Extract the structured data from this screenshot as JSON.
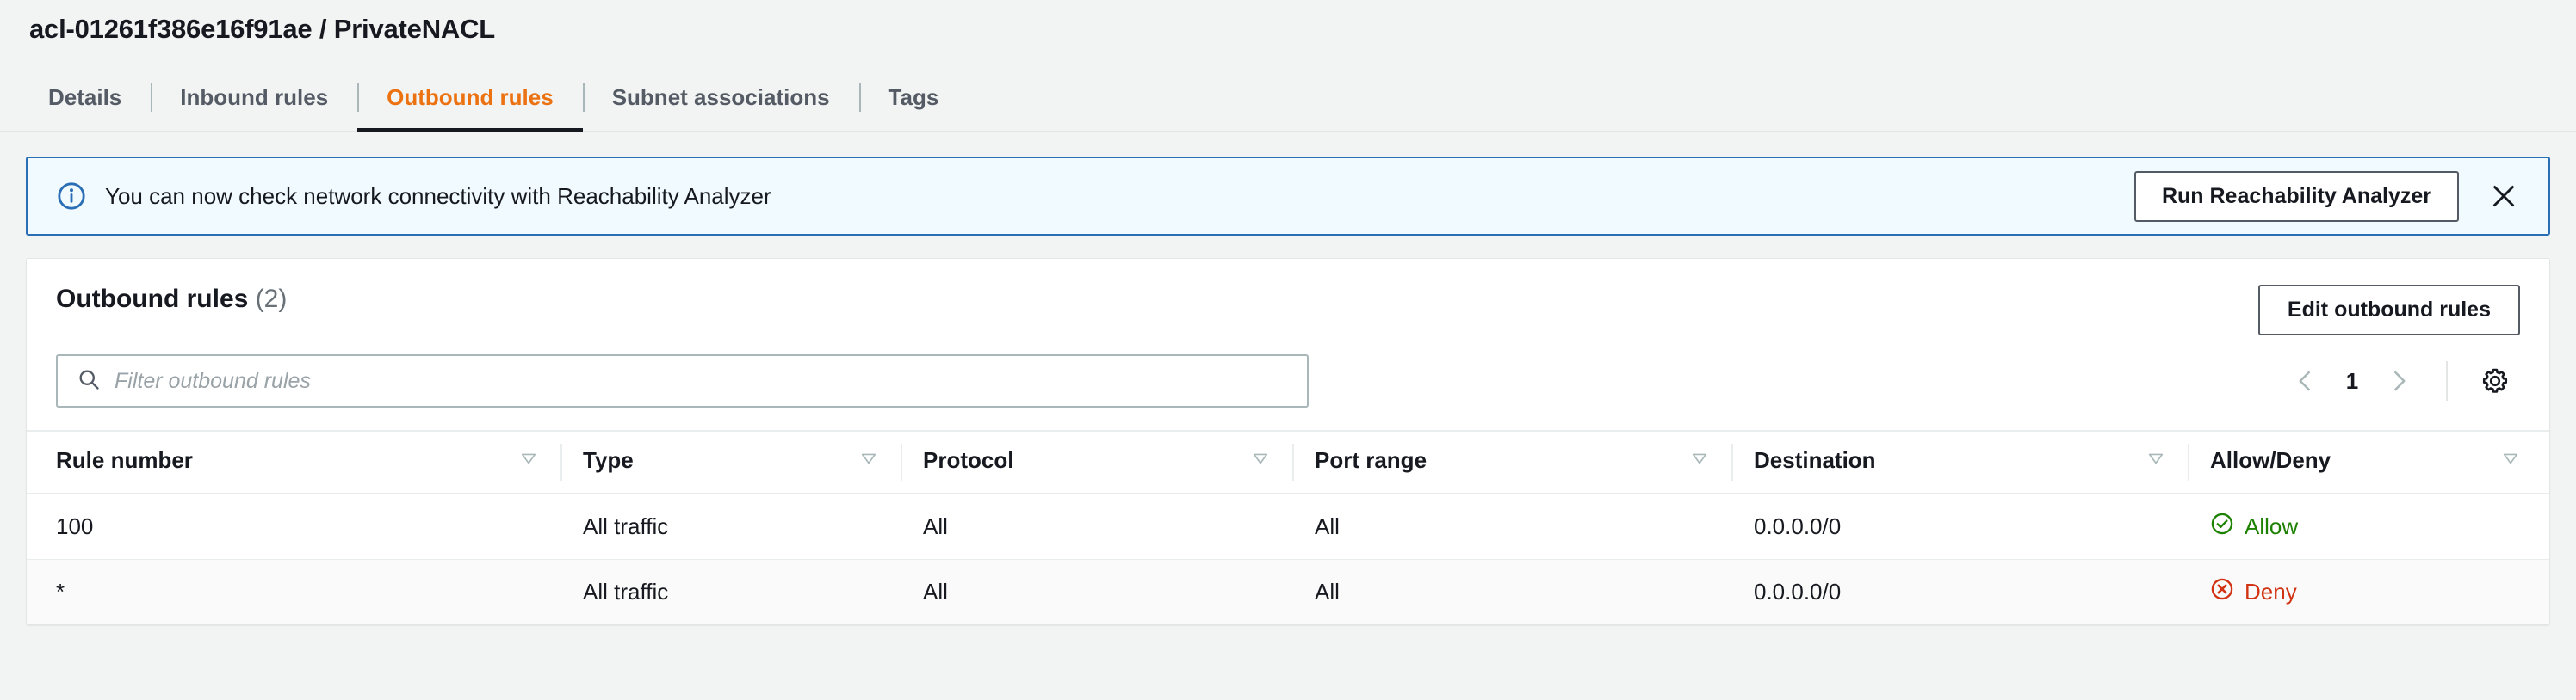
{
  "header": {
    "title": "acl-01261f386e16f91ae / PrivateNACL"
  },
  "tabs": [
    {
      "label": "Details",
      "active": false
    },
    {
      "label": "Inbound rules",
      "active": false
    },
    {
      "label": "Outbound rules",
      "active": true
    },
    {
      "label": "Subnet associations",
      "active": false
    },
    {
      "label": "Tags",
      "active": false
    }
  ],
  "banner": {
    "icon": "info-circle-icon",
    "message": "You can now check network connectivity with Reachability Analyzer",
    "action_label": "Run Reachability Analyzer",
    "close_icon": "close-icon",
    "border_color": "#2a6eb5",
    "background_color": "#f1faff"
  },
  "panel": {
    "title": "Outbound rules",
    "count": "(2)",
    "edit_label": "Edit outbound rules",
    "search": {
      "icon": "search-icon",
      "placeholder": "Filter outbound rules",
      "value": ""
    },
    "pagination": {
      "prev_icon": "chevron-left-icon",
      "page": "1",
      "next_icon": "chevron-right-icon"
    },
    "settings_icon": "gear-icon"
  },
  "table": {
    "columns": [
      {
        "label": "Rule number",
        "sort_icon": "sort-triangle-icon"
      },
      {
        "label": "Type",
        "sort_icon": "sort-triangle-icon"
      },
      {
        "label": "Protocol",
        "sort_icon": "sort-triangle-icon"
      },
      {
        "label": "Port range",
        "sort_icon": "sort-triangle-icon"
      },
      {
        "label": "Destination",
        "sort_icon": "sort-triangle-icon"
      },
      {
        "label": "Allow/Deny",
        "sort_icon": "sort-triangle-icon"
      }
    ],
    "rows": [
      {
        "rule_number": "100",
        "type": "All traffic",
        "protocol": "All",
        "port_range": "All",
        "destination": "0.0.0.0/0",
        "allow_deny": "Allow",
        "status_kind": "allow",
        "status_icon": "check-circle-icon",
        "status_color": "#1d8102"
      },
      {
        "rule_number": "*",
        "type": "All traffic",
        "protocol": "All",
        "port_range": "All",
        "destination": "0.0.0.0/0",
        "allow_deny": "Deny",
        "status_kind": "deny",
        "status_icon": "x-circle-icon",
        "status_color": "#d13212"
      }
    ]
  },
  "theme": {
    "accent": "#ec7211",
    "text": "#16191f",
    "muted": "#545b64",
    "page_bg": "#f2f3f3"
  }
}
